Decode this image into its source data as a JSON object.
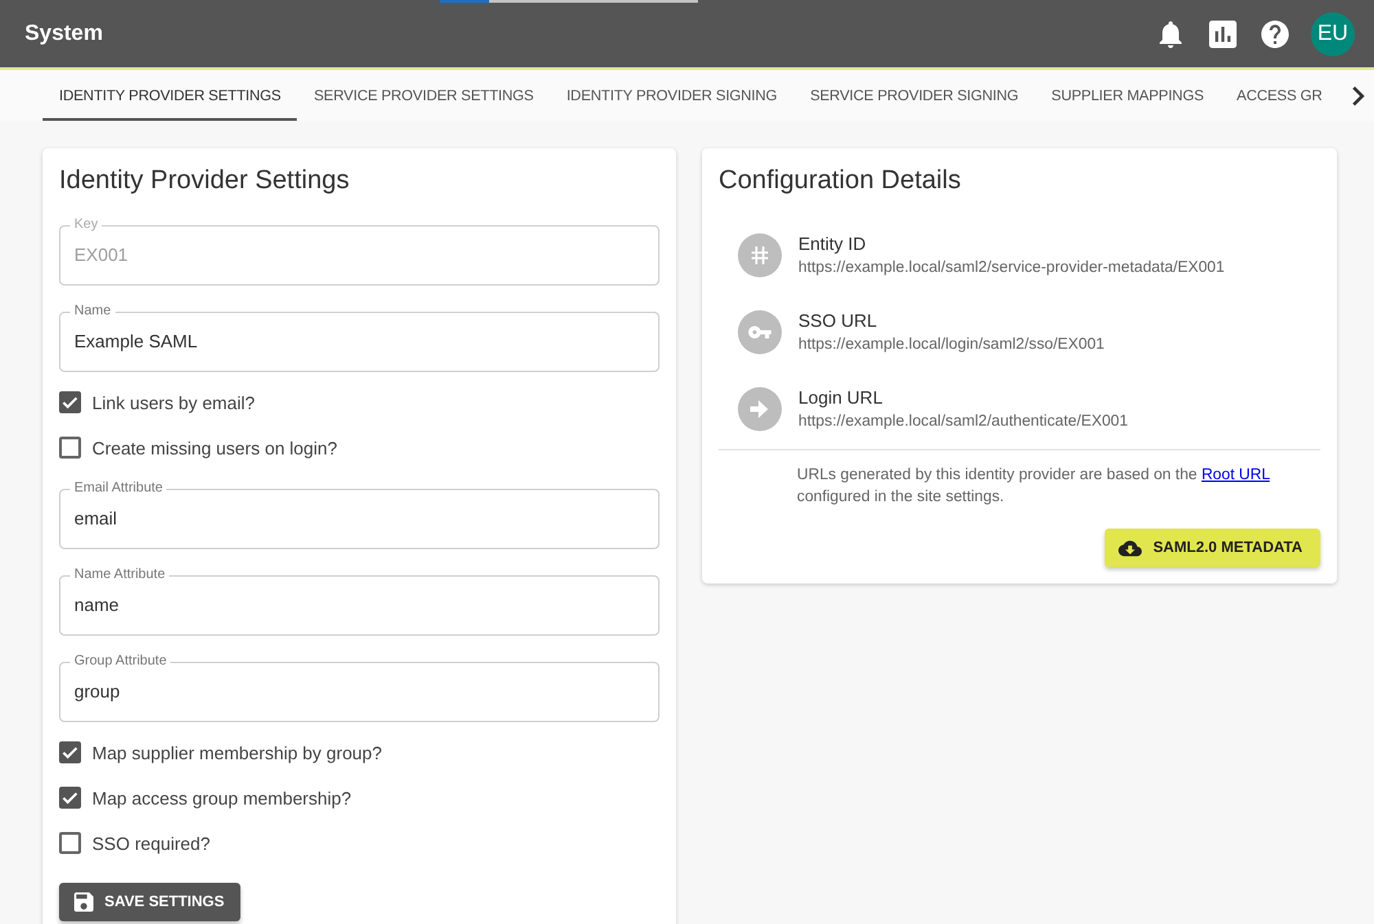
{
  "progress": {
    "level": 0.19
  },
  "header": {
    "title": "System",
    "avatar": "EU"
  },
  "tabs": [
    {
      "label": "IDENTITY PROVIDER SETTINGS",
      "selected": true
    },
    {
      "label": "SERVICE PROVIDER SETTINGS",
      "selected": false
    },
    {
      "label": "IDENTITY PROVIDER SIGNING",
      "selected": false
    },
    {
      "label": "SERVICE PROVIDER SIGNING",
      "selected": false
    },
    {
      "label": "SUPPLIER MAPPINGS",
      "selected": false
    },
    {
      "label": "ACCESS GR",
      "selected": false
    }
  ],
  "settings_card": {
    "title": "Identity Provider Settings",
    "form": [
      {
        "kind": "field",
        "label": "Key",
        "value": "EX001",
        "disabled": true
      },
      {
        "kind": "field",
        "label": "Name",
        "value": "Example SAML",
        "disabled": false
      },
      {
        "kind": "checkbox",
        "label": "Link users by email?",
        "checked": true,
        "disabled": false
      },
      {
        "kind": "checkbox",
        "label": "Create missing users on login?",
        "checked": false,
        "disabled": false
      },
      {
        "kind": "field",
        "label": "Email Attribute",
        "value": "email",
        "disabled": false
      },
      {
        "kind": "field",
        "label": "Name Attribute",
        "value": "name",
        "disabled": false
      },
      {
        "kind": "field",
        "label": "Group Attribute",
        "value": "group",
        "disabled": false
      },
      {
        "kind": "checkbox",
        "label": "Map supplier membership by group?",
        "checked": true,
        "disabled": false
      },
      {
        "kind": "checkbox",
        "label": "Map access group membership?",
        "checked": true,
        "disabled": false
      },
      {
        "kind": "checkbox",
        "label": "SSO required?",
        "checked": false,
        "disabled": false
      }
    ],
    "save_button": "SAVE SETTINGS"
  },
  "config_card": {
    "title": "Configuration Details",
    "items": [
      {
        "title": "Entity ID",
        "value": "https://example.local/saml2/service-provider-metadata/EX001"
      },
      {
        "title": "SSO URL",
        "value": "https://example.local/login/saml2/sso/EX001"
      },
      {
        "title": "Login URL",
        "value": "https://example.local/saml2/authenticate/EX001"
      }
    ],
    "note": {
      "before": "URLs generated by this identity provider are based on the",
      "link": "Root URL",
      "after": "configured in the site settings."
    },
    "button": "SAML2.0 METADATA"
  }
}
